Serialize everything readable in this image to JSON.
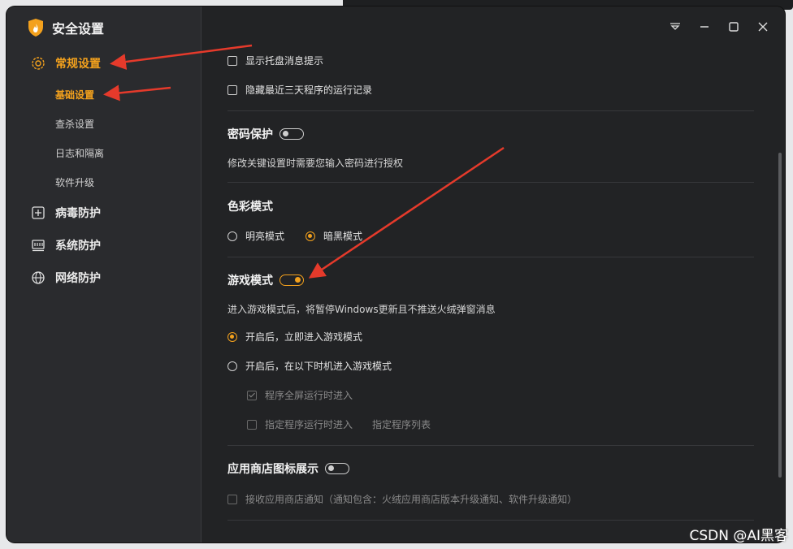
{
  "app": {
    "title": "安全设置",
    "accent": "#f3a11d"
  },
  "sidebar": {
    "items": [
      {
        "label": "常规设置",
        "icon": "gear-icon",
        "active": true
      },
      {
        "label": "病毒防护",
        "icon": "plus-square-icon"
      },
      {
        "label": "系统防护",
        "icon": "system-icon"
      },
      {
        "label": "网络防护",
        "icon": "globe-icon"
      }
    ],
    "subitems": [
      {
        "label": "基础设置",
        "active": true
      },
      {
        "label": "查杀设置"
      },
      {
        "label": "日志和隔离"
      },
      {
        "label": "软件升级"
      }
    ]
  },
  "window_controls": [
    "dropdown-icon",
    "minimize-icon",
    "maximize-icon",
    "close-icon"
  ],
  "main": {
    "tray_notify": {
      "label": "显示托盘消息提示",
      "checked": false
    },
    "hide_records": {
      "label": "隐藏最近三天程序的运行记录",
      "checked": false
    },
    "password": {
      "title": "密码保护",
      "enabled": false,
      "desc": "修改关键设置时需要您输入密码进行授权"
    },
    "color_mode": {
      "title": "色彩模式",
      "options": [
        "明亮模式",
        "暗黑模式"
      ],
      "selected": "暗黑模式"
    },
    "game_mode": {
      "title": "游戏模式",
      "enabled": true,
      "desc": "进入游戏模式后，将暂停Windows更新且不推送火绒弹窗消息",
      "option_immediate": "开启后，立即进入游戏模式",
      "option_timed": "开启后，在以下时机进入游戏模式",
      "sub_fullscreen": "程序全屏运行时进入",
      "sub_specified": "指定程序运行时进入",
      "program_list_link": "指定程序列表"
    },
    "store_icon": {
      "title": "应用商店图标展示",
      "enabled": false,
      "notify_label": "接收应用商店通知（通知包含：火绒应用商店版本升级通知、软件升级通知）"
    }
  },
  "watermark": "CSDN @AI黑客"
}
